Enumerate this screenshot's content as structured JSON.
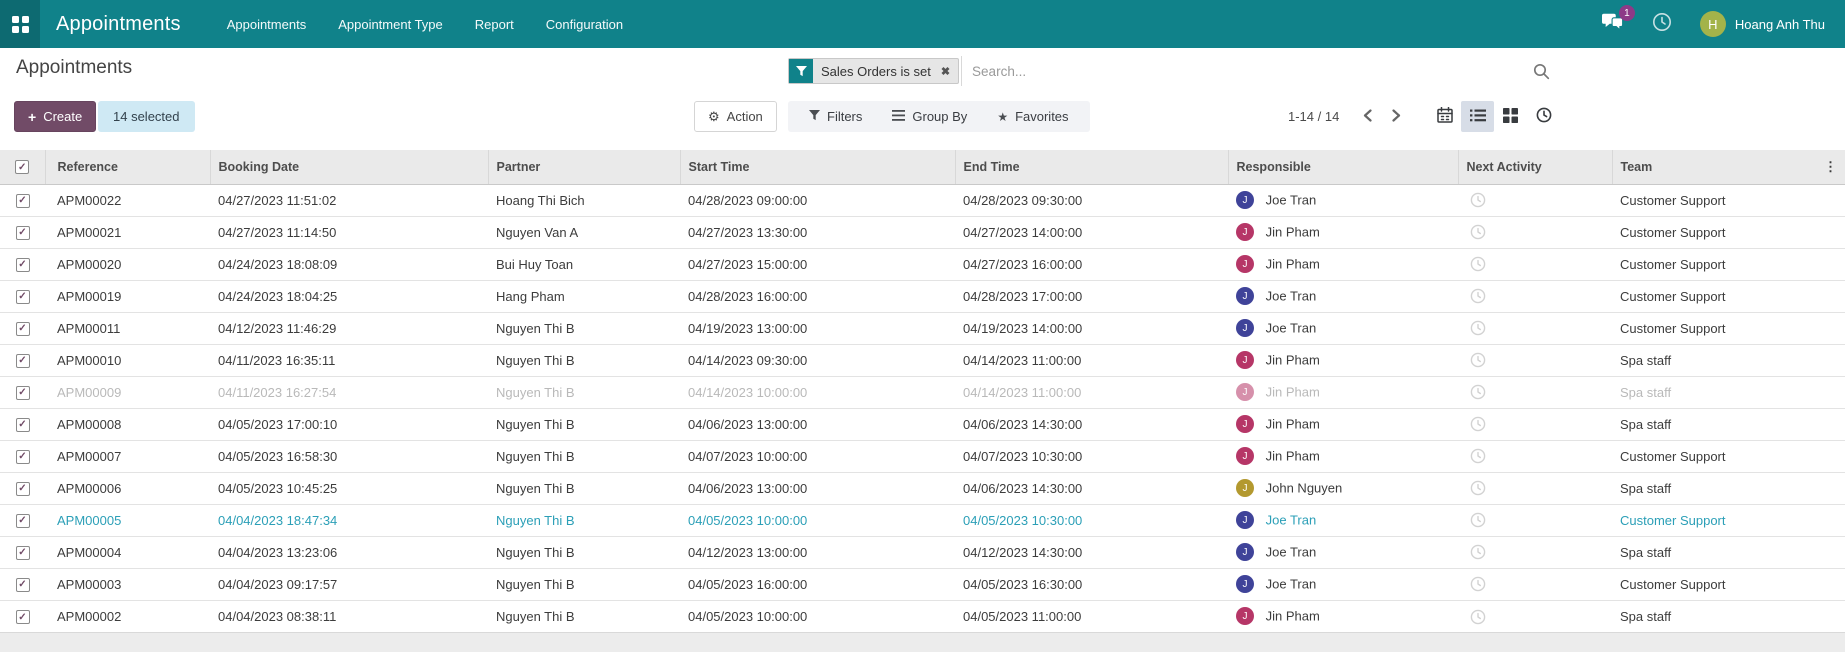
{
  "navbar": {
    "brand": "Appointments",
    "menus": [
      "Appointments",
      "Appointment Type",
      "Report",
      "Configuration"
    ],
    "messages_badge": "1",
    "user": {
      "name": "Hoang Anh Thu",
      "initial": "H"
    }
  },
  "breadcrumb": {
    "title": "Appointments"
  },
  "search": {
    "facet_label": "Sales Orders is set",
    "placeholder": "Search..."
  },
  "controls": {
    "create_label": "Create",
    "selected_label": "14 selected",
    "action_label": "Action",
    "filters_label": "Filters",
    "group_by_label": "Group By",
    "favorites_label": "Favorites",
    "pager_text": "1-14 / 14"
  },
  "icons": {
    "apps": "grid",
    "messages": "chat-bubbles",
    "navbar_right": "clock",
    "facet": "funnel",
    "facet_remove": "x",
    "search": "magnifier",
    "create": "plus",
    "action": "gear",
    "filters": "funnel",
    "group_by": "bars",
    "favorites": "star",
    "views": [
      "calendar",
      "list",
      "kanban",
      "activity-clock"
    ],
    "active_view": "list",
    "next_activity": "clock",
    "optional_columns": "kebab"
  },
  "colors": {
    "navbar_bg": "#10828a",
    "primary": "#714b67",
    "badge": "#8d3a87",
    "user_avatar": "#a3b34a",
    "selected_chip_bg": "#cfe9f4",
    "highlight_row": "#2b9fb7",
    "muted_row": "#b9b9b9"
  },
  "table": {
    "all_selected": true,
    "columns": [
      "Reference",
      "Booking Date",
      "Partner",
      "Start Time",
      "End Time",
      "Responsible",
      "Next Activity",
      "Team"
    ],
    "rows": [
      {
        "checked": true,
        "reference": "APM00022",
        "booking_date": "04/27/2023 11:51:02",
        "partner": "Hoang Thi Bich",
        "start_time": "04/28/2023 09:00:00",
        "end_time": "04/28/2023 09:30:00",
        "responsible": "Joe Tran",
        "responsible_initial": "J",
        "responsible_color": "#3f4399",
        "team": "Customer Support",
        "state": "normal"
      },
      {
        "checked": true,
        "reference": "APM00021",
        "booking_date": "04/27/2023 11:14:50",
        "partner": "Nguyen Van A",
        "start_time": "04/27/2023 13:30:00",
        "end_time": "04/27/2023 14:00:00",
        "responsible": "Jin Pham",
        "responsible_initial": "J",
        "responsible_color": "#b63667",
        "team": "Customer Support",
        "state": "normal"
      },
      {
        "checked": true,
        "reference": "APM00020",
        "booking_date": "04/24/2023 18:08:09",
        "partner": "Bui Huy Toan",
        "start_time": "04/27/2023 15:00:00",
        "end_time": "04/27/2023 16:00:00",
        "responsible": "Jin Pham",
        "responsible_initial": "J",
        "responsible_color": "#b63667",
        "team": "Customer Support",
        "state": "normal"
      },
      {
        "checked": true,
        "reference": "APM00019",
        "booking_date": "04/24/2023 18:04:25",
        "partner": "Hang Pham",
        "start_time": "04/28/2023 16:00:00",
        "end_time": "04/28/2023 17:00:00",
        "responsible": "Joe Tran",
        "responsible_initial": "J",
        "responsible_color": "#3f4399",
        "team": "Customer Support",
        "state": "normal"
      },
      {
        "checked": true,
        "reference": "APM00011",
        "booking_date": "04/12/2023 11:46:29",
        "partner": "Nguyen Thi B",
        "start_time": "04/19/2023 13:00:00",
        "end_time": "04/19/2023 14:00:00",
        "responsible": "Joe Tran",
        "responsible_initial": "J",
        "responsible_color": "#3f4399",
        "team": "Customer Support",
        "state": "normal"
      },
      {
        "checked": true,
        "reference": "APM00010",
        "booking_date": "04/11/2023 16:35:11",
        "partner": "Nguyen Thi B",
        "start_time": "04/14/2023 09:30:00",
        "end_time": "04/14/2023 11:00:00",
        "responsible": "Jin Pham",
        "responsible_initial": "J",
        "responsible_color": "#b63667",
        "team": "Spa staff",
        "state": "normal"
      },
      {
        "checked": true,
        "reference": "APM00009",
        "booking_date": "04/11/2023 16:27:54",
        "partner": "Nguyen Thi B",
        "start_time": "04/14/2023 10:00:00",
        "end_time": "04/14/2023 11:00:00",
        "responsible": "Jin Pham",
        "responsible_initial": "J",
        "responsible_color": "#b63667",
        "team": "Spa staff",
        "state": "muted"
      },
      {
        "checked": true,
        "reference": "APM00008",
        "booking_date": "04/05/2023 17:00:10",
        "partner": "Nguyen Thi B",
        "start_time": "04/06/2023 13:00:00",
        "end_time": "04/06/2023 14:30:00",
        "responsible": "Jin Pham",
        "responsible_initial": "J",
        "responsible_color": "#b63667",
        "team": "Spa staff",
        "state": "normal"
      },
      {
        "checked": true,
        "reference": "APM00007",
        "booking_date": "04/05/2023 16:58:30",
        "partner": "Nguyen Thi B",
        "start_time": "04/07/2023 10:00:00",
        "end_time": "04/07/2023 10:30:00",
        "responsible": "Jin Pham",
        "responsible_initial": "J",
        "responsible_color": "#b63667",
        "team": "Customer Support",
        "state": "normal"
      },
      {
        "checked": true,
        "reference": "APM00006",
        "booking_date": "04/05/2023 10:45:25",
        "partner": "Nguyen Thi B",
        "start_time": "04/06/2023 13:00:00",
        "end_time": "04/06/2023 14:30:00",
        "responsible": "John Nguyen",
        "responsible_initial": "J",
        "responsible_color": "#b3992f",
        "team": "Spa staff",
        "state": "normal"
      },
      {
        "checked": true,
        "reference": "APM00005",
        "booking_date": "04/04/2023 18:47:34",
        "partner": "Nguyen Thi B",
        "start_time": "04/05/2023 10:00:00",
        "end_time": "04/05/2023 10:30:00",
        "responsible": "Joe Tran",
        "responsible_initial": "J",
        "responsible_color": "#3f4399",
        "team": "Customer Support",
        "state": "highlight"
      },
      {
        "checked": true,
        "reference": "APM00004",
        "booking_date": "04/04/2023 13:23:06",
        "partner": "Nguyen Thi B",
        "start_time": "04/12/2023 13:00:00",
        "end_time": "04/12/2023 14:30:00",
        "responsible": "Joe Tran",
        "responsible_initial": "J",
        "responsible_color": "#3f4399",
        "team": "Spa staff",
        "state": "normal"
      },
      {
        "checked": true,
        "reference": "APM00003",
        "booking_date": "04/04/2023 09:17:57",
        "partner": "Nguyen Thi B",
        "start_time": "04/05/2023 16:00:00",
        "end_time": "04/05/2023 16:30:00",
        "responsible": "Joe Tran",
        "responsible_initial": "J",
        "responsible_color": "#3f4399",
        "team": "Customer Support",
        "state": "normal"
      },
      {
        "checked": true,
        "reference": "APM00002",
        "booking_date": "04/04/2023 08:38:11",
        "partner": "Nguyen Thi B",
        "start_time": "04/05/2023 10:00:00",
        "end_time": "04/05/2023 11:00:00",
        "responsible": "Jin Pham",
        "responsible_initial": "J",
        "responsible_color": "#b63667",
        "team": "Spa staff",
        "state": "normal"
      }
    ]
  }
}
